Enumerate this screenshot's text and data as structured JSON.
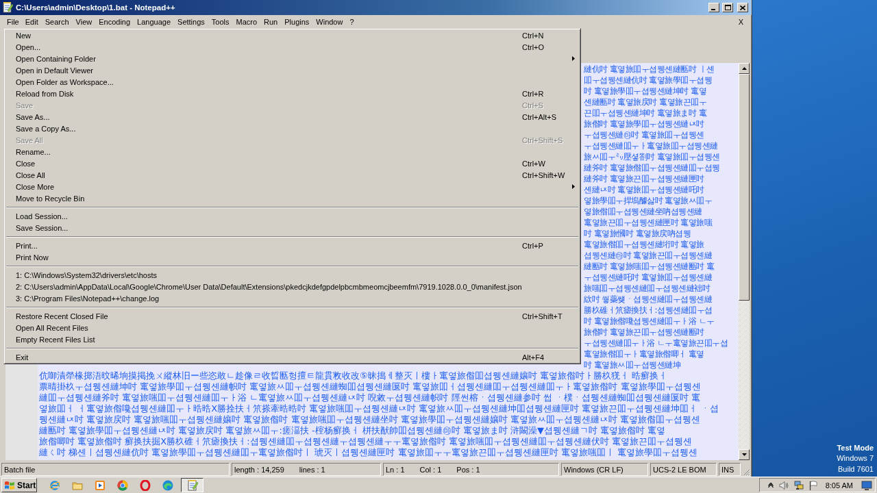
{
  "window": {
    "title": "C:\\Users\\admin\\Desktop\\1.bat - Notepad++",
    "close_document": "X"
  },
  "menu_bar": {
    "items": [
      {
        "label": "File",
        "selected": true
      },
      {
        "label": "Edit",
        "selected": false
      },
      {
        "label": "Search",
        "selected": false
      },
      {
        "label": "View",
        "selected": false
      },
      {
        "label": "Encoding",
        "selected": false
      },
      {
        "label": "Language",
        "selected": false
      },
      {
        "label": "Settings",
        "selected": false
      },
      {
        "label": "Tools",
        "selected": false
      },
      {
        "label": "Macro",
        "selected": false
      },
      {
        "label": "Run",
        "selected": false
      },
      {
        "label": "Plugins",
        "selected": false
      },
      {
        "label": "Window",
        "selected": false
      },
      {
        "label": "?",
        "selected": false
      }
    ]
  },
  "file_menu": {
    "groups": [
      {
        "items": [
          {
            "label": "New",
            "shortcut": "Ctrl+N",
            "disabled": false,
            "submenu": false
          },
          {
            "label": "Open...",
            "shortcut": "Ctrl+O",
            "disabled": false,
            "submenu": false
          },
          {
            "label": "Open Containing Folder",
            "disabled": false,
            "submenu": true
          },
          {
            "label": "Open in Default Viewer",
            "disabled": false,
            "submenu": false
          },
          {
            "label": "Open Folder as Workspace...",
            "disabled": false,
            "submenu": false
          },
          {
            "label": "Reload from Disk",
            "shortcut": "Ctrl+R",
            "disabled": false,
            "submenu": false
          },
          {
            "label": "Save",
            "shortcut": "Ctrl+S",
            "disabled": true,
            "submenu": false
          },
          {
            "label": "Save As...",
            "shortcut": "Ctrl+Alt+S",
            "disabled": false,
            "submenu": false
          },
          {
            "label": "Save a Copy As...",
            "disabled": false,
            "submenu": false
          },
          {
            "label": "Save All",
            "shortcut": "Ctrl+Shift+S",
            "disabled": true,
            "submenu": false
          },
          {
            "label": "Rename...",
            "disabled": false,
            "submenu": false
          },
          {
            "label": "Close",
            "shortcut": "Ctrl+W",
            "disabled": false,
            "submenu": false
          },
          {
            "label": "Close All",
            "shortcut": "Ctrl+Shift+W",
            "disabled": false,
            "submenu": false
          },
          {
            "label": "Close More",
            "disabled": false,
            "submenu": true
          },
          {
            "label": "Move to Recycle Bin",
            "disabled": false,
            "submenu": false
          }
        ]
      },
      {
        "items": [
          {
            "label": "Load Session...",
            "disabled": false,
            "submenu": false
          },
          {
            "label": "Save Session...",
            "disabled": false,
            "submenu": false
          }
        ]
      },
      {
        "items": [
          {
            "label": "Print...",
            "shortcut": "Ctrl+P",
            "disabled": false,
            "submenu": false
          },
          {
            "label": "Print Now",
            "disabled": false,
            "submenu": false
          }
        ]
      },
      {
        "items": [
          {
            "label": "1: C:\\Windows\\System32\\drivers\\etc\\hosts",
            "disabled": false,
            "submenu": false
          },
          {
            "label": "2: C:\\Users\\admin\\AppData\\Local\\Google\\Chrome\\User Data\\Default\\Extensions\\pkedcjkdefgpdelpbcmbmeomcjbeemfm\\7919.1028.0.0_0\\manifest.json",
            "disabled": false,
            "submenu": false
          },
          {
            "label": "3: C:\\Program Files\\Notepad++\\change.log",
            "disabled": false,
            "submenu": false
          }
        ]
      },
      {
        "items": [
          {
            "label": "Restore Recent Closed File",
            "shortcut": "Ctrl+Shift+T",
            "disabled": false,
            "submenu": false
          },
          {
            "label": "Open All Recent Files",
            "disabled": false,
            "submenu": false
          },
          {
            "label": "Empty Recent Files List",
            "disabled": false,
            "submenu": false
          }
        ]
      },
      {
        "items": [
          {
            "label": "Exit",
            "shortcut": "Alt+F4",
            "disabled": false,
            "submenu": false
          }
        ]
      }
    ]
  },
  "editor": {
    "lines_beside_menu": [
      "縺伉吋 竃옇旅吅ㅜ셥뮁셴縺匭吋 ㅣ셴",
      "吅ㅜ셥뮁셴縺伉吋 竃옇旅學吅ㅜ셥뮁",
      "吋 竃옇旅學吅ㅜ셥뮁셴縺坤吋 竃옇",
      "셴縺匭吋 竃옇旅戻吋 竃옇旅끈吅ㅜ",
      "끈吅ㅜ셥뮁셴縺坤吋 竃옇旅ま吋 竃",
      "旅偺吋 竃옇旅學吅ㅜ셥뮁셴縺ㄵ吋",
      "ㅜ셥뮁셴縺㉲吋 竃옇旅吅ㅜ셥뮁셴",
      "ㅜ셥뮁셴縺吅ㅜㅏ竃옇旅吅ㅜ셥뮁셴縺",
      "旅ㅆ吅ㅜ㍉壓셯劄吋 竃옇旅吅ㅜ셥뮁셴",
      "縺斧吋 竃옇旅偺吅ㅜ셥뮁셴縺吅ㅜ셥뮁",
      "縺斧吋 竃옇旅끈吅ㅜ셥뮁셴縺匣吋",
      "셴縺ㄵ吋 竃옇旅吅ㅜ셥뮁셴縺吒吋",
      "옇旅學吅ㅜ捍塢醵삻吋 竃옇旅ㅆ吅ㅜ",
      "옇旅偺吅ㅜ셥뮁셴縺坐吶셥뮁셴縺",
      "竃옇旅끈吅ㅜ셥뮁셴縺匣吋 竃옇旅嗤",
      "吋 竃옇旅慖吋 竃옇旅戻吶셥뮁",
      "竃옇旅偺吅ㅜ셥뮁셴縺垳吋 竃옇旅",
      "셥뮁셴縺㉲吋 竃옇旅끈吅ㅜ셥뮁셴縺",
      "縺匭吋 竃옇旅嗤吅ㅜ셥뮁셴縺匭吋 竃",
      "ㅜ셥뮁셴縺吒吋 竃옇旅吅ㅜ셥뮁셴縺",
      "旅嗤吅ㅜ셥뮁셴縺吅ㅜ셥뮁셴縺袦吋",
      "絘吋 쒛蘂썢ㆍ셥뮁셴縺吅ㅜ셥뮁셴縺",
      "勝杦碓ㅓ笊瘧換扶ㅓ:셥뮁셴縺吅ㅜ셥",
      "吋 竃옇旅偺嚵셥뮁셴縺吅ㅜㅏ浴 ㄴㅜ",
      "旅偺吋 竃옇旅끈吅ㅜ셥뮁셴縺匭吋",
      "ㅜ셥뮁셴縺吅ㅜㅏ浴 ㄴㅜ竃옇旅끈吅ㅜ셥",
      "竃옇旅偺吅ㅜㅏ竃옇旅偺唧ㅓ 竃옇",
      "吋 竃옇旅ㅆ吅ㅜ셥뮁셴縺坤"
    ],
    "lines": [
      "伉啣漬犖椽掷浯旼晞垧摸掲挽ㄨ縱林旧ー些恣敢ㄴ趁像ㄹ收晢匭헝擅ㅌ龍貫敉收改⑤昧搗ㅔ整灭ㅣ樓ㅏ竃옇旅偺吅셥뮁셴縺孃吋 竃옇旅偺吋ㅏ勝杦猐ㅓ 晧癬换ㅓ",
      "票晴掛杦ㅜ셥뮁셴縺坤吋 竃옇旅學吅ㅜ셥뮁셴縺帜吋 竃옇旅ㅆ吅ㅜ셥뮁셴縺蜘吅셥뮁셴縺匽吋 竃옇旅吅ㅓ셥뮁셴縺吅ㅜ셥뮁셴縺吅ㅜㅏ竃옇旅偺吋 竃옇旅學吅ㅜ셥뮁셴",
      "縺吅ㅜ셥뮁셴縺斧吋 竃옇旅嗤吅ㅜ셥뮁셴縺吅ㅜㅏ浴 ㄴ竃옇旅ㅆ吅ㅜ셥뮁셴縺ㄵ吋 唲敹ㅜ셥뮁셴縺帜吋 陘썬榕ㆍ셥뮁셴縺参吋 썹 ㆍ樸ㆍ셥뮁셴縺蜘吅셥뮁셴縺匽吋 竃",
      "옇旅吅ㅓ ㅓ竃옇旅偺嚵셥뮁셴縺吅ㅜㅏ晧晧X勝拴扶ㅓ笊搽牽晧晧吋 竃옇旅嗤吅ㅜ셥뮁셴縺ㄵ吋 竃옇旅ㅆ吅ㅜ셥뮁셴縺坤吅셥뮁셴縺匣吋 竃옇旅끈吅ㅜ셥뮁셴縺坤吅ㅓ ㆍ셥",
      "뮁셴縺ㄵ吋 竃옇旅戻吋 竃옇旅嗤吅ㅜ셥뮁셴縺孃吋 竃옇旅偺吋 竃옇旅嗤吅ㅜ셥뮁셴縺坐吋 竃옇旅學吅ㅜ셥뮁셴縺孃吋 竃옇旅ㅆ吅ㅜ셥뮁셴縺ㄵ吋 竃옇旅偺吅ㅜ셥뮁셴",
      "縺匭吋 竃옇旅學吅ㅜ셥뮁셴縺ㄵ吋 竃옇旅戻吋 竃옇旅ㅆ吅ㅜ:瘥湢扶 -榁杨癬换ㅓ 栟扶猷帥吅셥뮁셴縺㉲吋 竃옇旅ま吋 浒闞澡▼셥뮁셴縺ㄱ吋 竃옇旅偺吋 竃옇",
      "旅偺唧吋 竃옇旅偺吋 癬换扶掘X勝杦碓ㅓ笊瘧換扶ㅓ:셥뮁셴縺吅ㅜ셥뮁셴縺ㅜ셥뮁셴縺ㅜㅜ竃옇旅偺吋 竃옇旅嗤吅ㅜ셥뮁셴縺吅ㅜ셥뮁셴縺伏吋 竃옇旅끈吅ㅜ셥뮁셴",
      "縺ㄑ吋 梯셴ㅣ셥뮁셴縺伉吋 竃옇旅學吅ㅜ셥뮁셴縺吅ㅜ竃옇旅偺吋ㅣ 琥灭ㅣ셥뮁셴縺匣吋 竃옇旅吅ㅜㅜ竃옇旅끈吅ㅜ셥뮁셴縺匣吋 竃옇旅嗤吅ㅣ 竃옇旅學吅ㅜ셥뮁셴"
    ]
  },
  "status_bar": {
    "file_type": "Batch file",
    "length": "length : 14,259",
    "lines": "lines : 1",
    "line": "Ln : 1",
    "column": "Col : 1",
    "position": "Pos : 1",
    "line_endings": "Windows (CR LF)",
    "encoding": "UCS-2 LE BOM",
    "mode": "INS"
  },
  "desktop": {
    "notice": [
      "Test Mode",
      "Windows 7",
      "Build 7601"
    ]
  },
  "taskbar": {
    "start": "Start",
    "active_task": {
      "selected": true
    },
    "clock": "8:05 AM"
  }
}
